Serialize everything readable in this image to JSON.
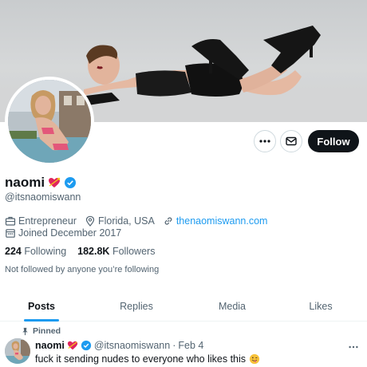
{
  "profile": {
    "display_name": "naomi",
    "handle": "@itsnaomiswann",
    "verified": true,
    "name_emoji": "heart-with-arrow-icon",
    "bio_items": {
      "category": "Entrepreneur",
      "location": "Florida, USA",
      "website": "thenaomiswann.com",
      "joined": "Joined December 2017"
    },
    "following_count": "224",
    "following_label": "Following",
    "followers_count": "182.8K",
    "followers_label": "Followers",
    "not_followed": "Not followed by anyone you’re following"
  },
  "actions": {
    "more_icon": "more-icon",
    "message_icon": "mail-icon",
    "follow_label": "Follow"
  },
  "tabs": [
    {
      "label": "Posts",
      "active": true
    },
    {
      "label": "Replies",
      "active": false
    },
    {
      "label": "Media",
      "active": false
    },
    {
      "label": "Likes",
      "active": false
    }
  ],
  "pinned_tweet": {
    "pinned_label": "Pinned",
    "author_name": "naomi",
    "author_handle": "@itsnaomiswann",
    "separator": "·",
    "date": "Feb 4",
    "text": "fuck it sending nudes to everyone who likes this",
    "text_emoji": "tongue-wink-emoji"
  },
  "colors": {
    "accent": "#1d9bf0",
    "text_primary": "#0f1419",
    "text_secondary": "#536471",
    "follow_button_bg": "#0f1419"
  }
}
